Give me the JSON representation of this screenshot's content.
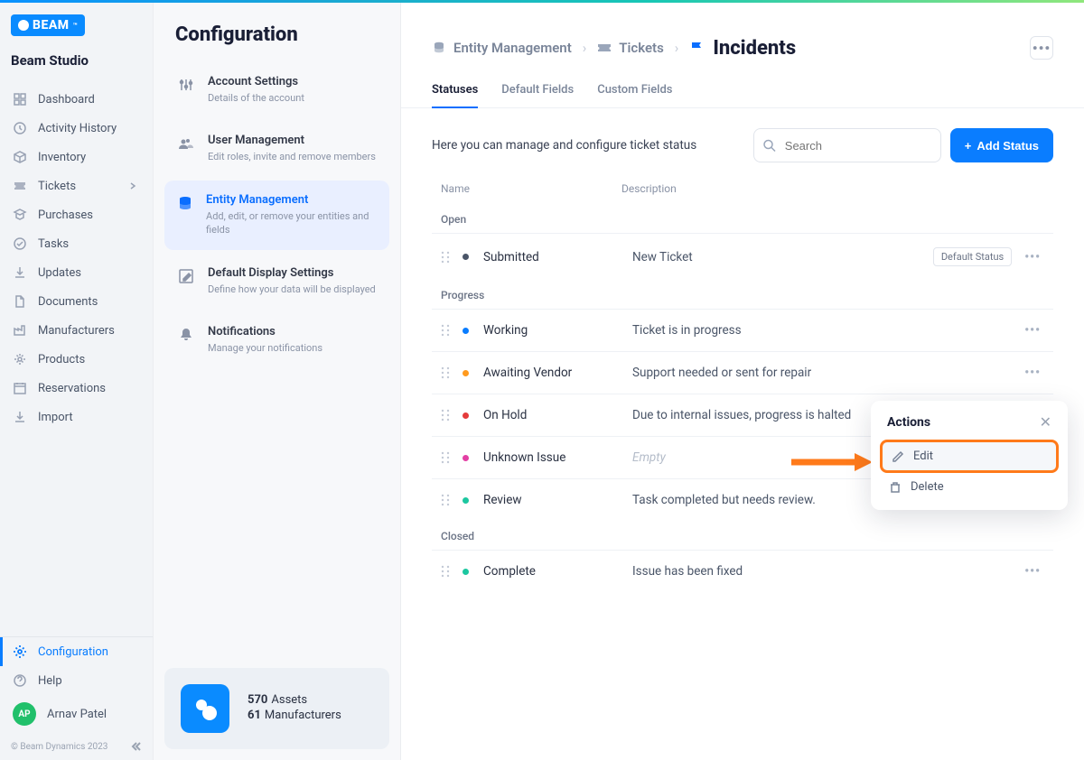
{
  "brand": {
    "logo_text": "BEAM",
    "app_title": "Beam Studio"
  },
  "sidebar": {
    "items": [
      {
        "label": "Dashboard"
      },
      {
        "label": "Activity History"
      },
      {
        "label": "Inventory"
      },
      {
        "label": "Tickets"
      },
      {
        "label": "Purchases"
      },
      {
        "label": "Tasks"
      },
      {
        "label": "Updates"
      },
      {
        "label": "Documents"
      },
      {
        "label": "Manufacturers"
      },
      {
        "label": "Products"
      },
      {
        "label": "Reservations"
      },
      {
        "label": "Import"
      }
    ],
    "bottom": {
      "configuration": "Configuration",
      "help": "Help",
      "user_initials": "AP",
      "user_name": "Arnav Patel"
    },
    "copyright": "© Beam Dynamics 2023"
  },
  "config": {
    "title": "Configuration",
    "items": [
      {
        "title": "Account Settings",
        "desc": "Details of the account"
      },
      {
        "title": "User Management",
        "desc": "Edit roles, invite and remove members"
      },
      {
        "title": "Entity Management",
        "desc": "Add, edit, or remove your entities and fields"
      },
      {
        "title": "Default Display Settings",
        "desc": "Define how your data will be displayed"
      },
      {
        "title": "Notifications",
        "desc": "Manage your notifications"
      }
    ],
    "footer": {
      "stat1_num": "570",
      "stat1_lbl": "Assets",
      "stat2_num": "61",
      "stat2_lbl": "Manufacturers"
    }
  },
  "main": {
    "breadcrumb": {
      "a": "Entity Management",
      "b": "Tickets",
      "c": "Incidents"
    },
    "tabs": {
      "a": "Statuses",
      "b": "Default Fields",
      "c": "Custom Fields"
    },
    "toolbar": {
      "desc": "Here you can manage and configure ticket status",
      "search_placeholder": "Search",
      "add_label": "Add Status"
    },
    "thead": {
      "name": "Name",
      "desc": "Description"
    },
    "groups": {
      "open": "Open",
      "progress": "Progress",
      "closed": "Closed"
    },
    "rows": {
      "submitted": {
        "name": "Submitted",
        "desc": "New Ticket",
        "color": "#4a5568",
        "badge": "Default Status"
      },
      "working": {
        "name": "Working",
        "desc": "Ticket is in progress",
        "color": "#0a7dff"
      },
      "vendor": {
        "name": "Awaiting Vendor",
        "desc": "Support needed or sent for repair",
        "color": "#ff9a1e"
      },
      "hold": {
        "name": "On Hold",
        "desc": "Due to internal issues, progress is halted",
        "color": "#e43b3b"
      },
      "unknown": {
        "name": "Unknown Issue",
        "desc": "Empty",
        "color": "#e33fa4"
      },
      "review": {
        "name": "Review",
        "desc": "Task completed but needs review.",
        "color": "#1cc7a0"
      },
      "complete": {
        "name": "Complete",
        "desc": "Issue has been fixed",
        "color": "#1cc7a0"
      }
    },
    "popover": {
      "title": "Actions",
      "edit": "Edit",
      "delete": "Delete"
    }
  },
  "colors": {
    "accent": "#0a7dff",
    "annotation": "#ff7a1a"
  }
}
